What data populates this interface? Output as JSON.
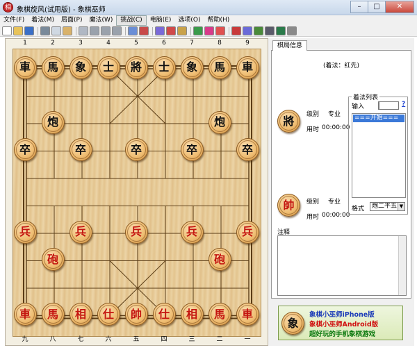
{
  "window": {
    "title": "象棋旋风(试用版) - 象棋巫师",
    "icon_char": "相",
    "controls": {
      "minimize": "–",
      "maximize": "□",
      "close": "✕"
    }
  },
  "menu": [
    {
      "label": "文件(F)"
    },
    {
      "label": "着法(M)"
    },
    {
      "label": "局面(P)"
    },
    {
      "label": "魔法(W)"
    },
    {
      "label": "挑战(C)",
      "active": true
    },
    {
      "label": "电脑(E)"
    },
    {
      "label": "选项(O)"
    },
    {
      "label": "帮助(H)"
    }
  ],
  "toolbar_icons": [
    "new-icon",
    "open-icon",
    "save-icon",
    "sep",
    "print-icon",
    "copy-icon",
    "paste-icon",
    "sep",
    "first-move-icon",
    "prev-move-icon",
    "next-move-icon",
    "last-move-icon",
    "sep",
    "cut-icon",
    "copy-board-icon",
    "sep",
    "flip-board-icon",
    "edit-board-icon",
    "analyze-icon",
    "sep",
    "color-icon",
    "magic-icon",
    "hint-icon",
    "sep",
    "book-icon",
    "clock-icon",
    "engine-icon",
    "computer-icon",
    "screen-icon",
    "stop-icon"
  ],
  "colors": {
    "red_piece_text": "#c4150f",
    "black_piece_text": "#111111",
    "board_line": "#5a3c16",
    "list_selection": "#3b79d8"
  },
  "board": {
    "files_top": [
      "1",
      "2",
      "3",
      "4",
      "5",
      "6",
      "7",
      "8",
      "9"
    ],
    "files_bottom": [
      "九",
      "八",
      "七",
      "六",
      "五",
      "四",
      "三",
      "二",
      "一"
    ],
    "pieces": [
      {
        "char": "車",
        "side": "black",
        "file": 0,
        "rank": 0
      },
      {
        "char": "馬",
        "side": "black",
        "file": 1,
        "rank": 0
      },
      {
        "char": "象",
        "side": "black",
        "file": 2,
        "rank": 0
      },
      {
        "char": "士",
        "side": "black",
        "file": 3,
        "rank": 0
      },
      {
        "char": "將",
        "side": "black",
        "file": 4,
        "rank": 0
      },
      {
        "char": "士",
        "side": "black",
        "file": 5,
        "rank": 0
      },
      {
        "char": "象",
        "side": "black",
        "file": 6,
        "rank": 0
      },
      {
        "char": "馬",
        "side": "black",
        "file": 7,
        "rank": 0
      },
      {
        "char": "車",
        "side": "black",
        "file": 8,
        "rank": 0
      },
      {
        "char": "炮",
        "side": "black",
        "file": 1,
        "rank": 2
      },
      {
        "char": "炮",
        "side": "black",
        "file": 7,
        "rank": 2
      },
      {
        "char": "卒",
        "side": "black",
        "file": 0,
        "rank": 3
      },
      {
        "char": "卒",
        "side": "black",
        "file": 2,
        "rank": 3
      },
      {
        "char": "卒",
        "side": "black",
        "file": 4,
        "rank": 3
      },
      {
        "char": "卒",
        "side": "black",
        "file": 6,
        "rank": 3
      },
      {
        "char": "卒",
        "side": "black",
        "file": 8,
        "rank": 3
      },
      {
        "char": "兵",
        "side": "red",
        "file": 0,
        "rank": 6
      },
      {
        "char": "兵",
        "side": "red",
        "file": 2,
        "rank": 6
      },
      {
        "char": "兵",
        "side": "red",
        "file": 4,
        "rank": 6
      },
      {
        "char": "兵",
        "side": "red",
        "file": 6,
        "rank": 6
      },
      {
        "char": "兵",
        "side": "red",
        "file": 8,
        "rank": 6
      },
      {
        "char": "砲",
        "side": "red",
        "file": 1,
        "rank": 7
      },
      {
        "char": "砲",
        "side": "red",
        "file": 7,
        "rank": 7
      },
      {
        "char": "車",
        "side": "red",
        "file": 0,
        "rank": 9
      },
      {
        "char": "馬",
        "side": "red",
        "file": 1,
        "rank": 9
      },
      {
        "char": "相",
        "side": "red",
        "file": 2,
        "rank": 9
      },
      {
        "char": "仕",
        "side": "red",
        "file": 3,
        "rank": 9
      },
      {
        "char": "帥",
        "side": "red",
        "file": 4,
        "rank": 9
      },
      {
        "char": "仕",
        "side": "red",
        "file": 5,
        "rank": 9
      },
      {
        "char": "相",
        "side": "red",
        "file": 6,
        "rank": 9
      },
      {
        "char": "馬",
        "side": "red",
        "file": 7,
        "rank": 9
      },
      {
        "char": "車",
        "side": "red",
        "file": 8,
        "rank": 9
      }
    ]
  },
  "panel": {
    "tab_label": "棋局信息",
    "move_side": "(着法：红先)",
    "black_player": {
      "piece": "將",
      "level_label": "级别",
      "level_value": "专业",
      "time_label": "用时",
      "time_value": "00:00:00"
    },
    "red_player": {
      "piece": "帥",
      "level_label": "级别",
      "level_value": "专业",
      "time_label": "用时",
      "time_value": "00:00:00"
    },
    "move_list": {
      "title": "着法列表",
      "input_label": "输入",
      "help": "?",
      "items": [
        "===开始==="
      ],
      "format_label": "格式",
      "format_value": "炮二平五"
    },
    "notes_label": "注释",
    "ad": {
      "piece": "象",
      "line1": "象棋小巫师iPhone版",
      "line2": "象棋小巫师Android版",
      "line3": "超好玩的手机象棋游戏"
    }
  }
}
